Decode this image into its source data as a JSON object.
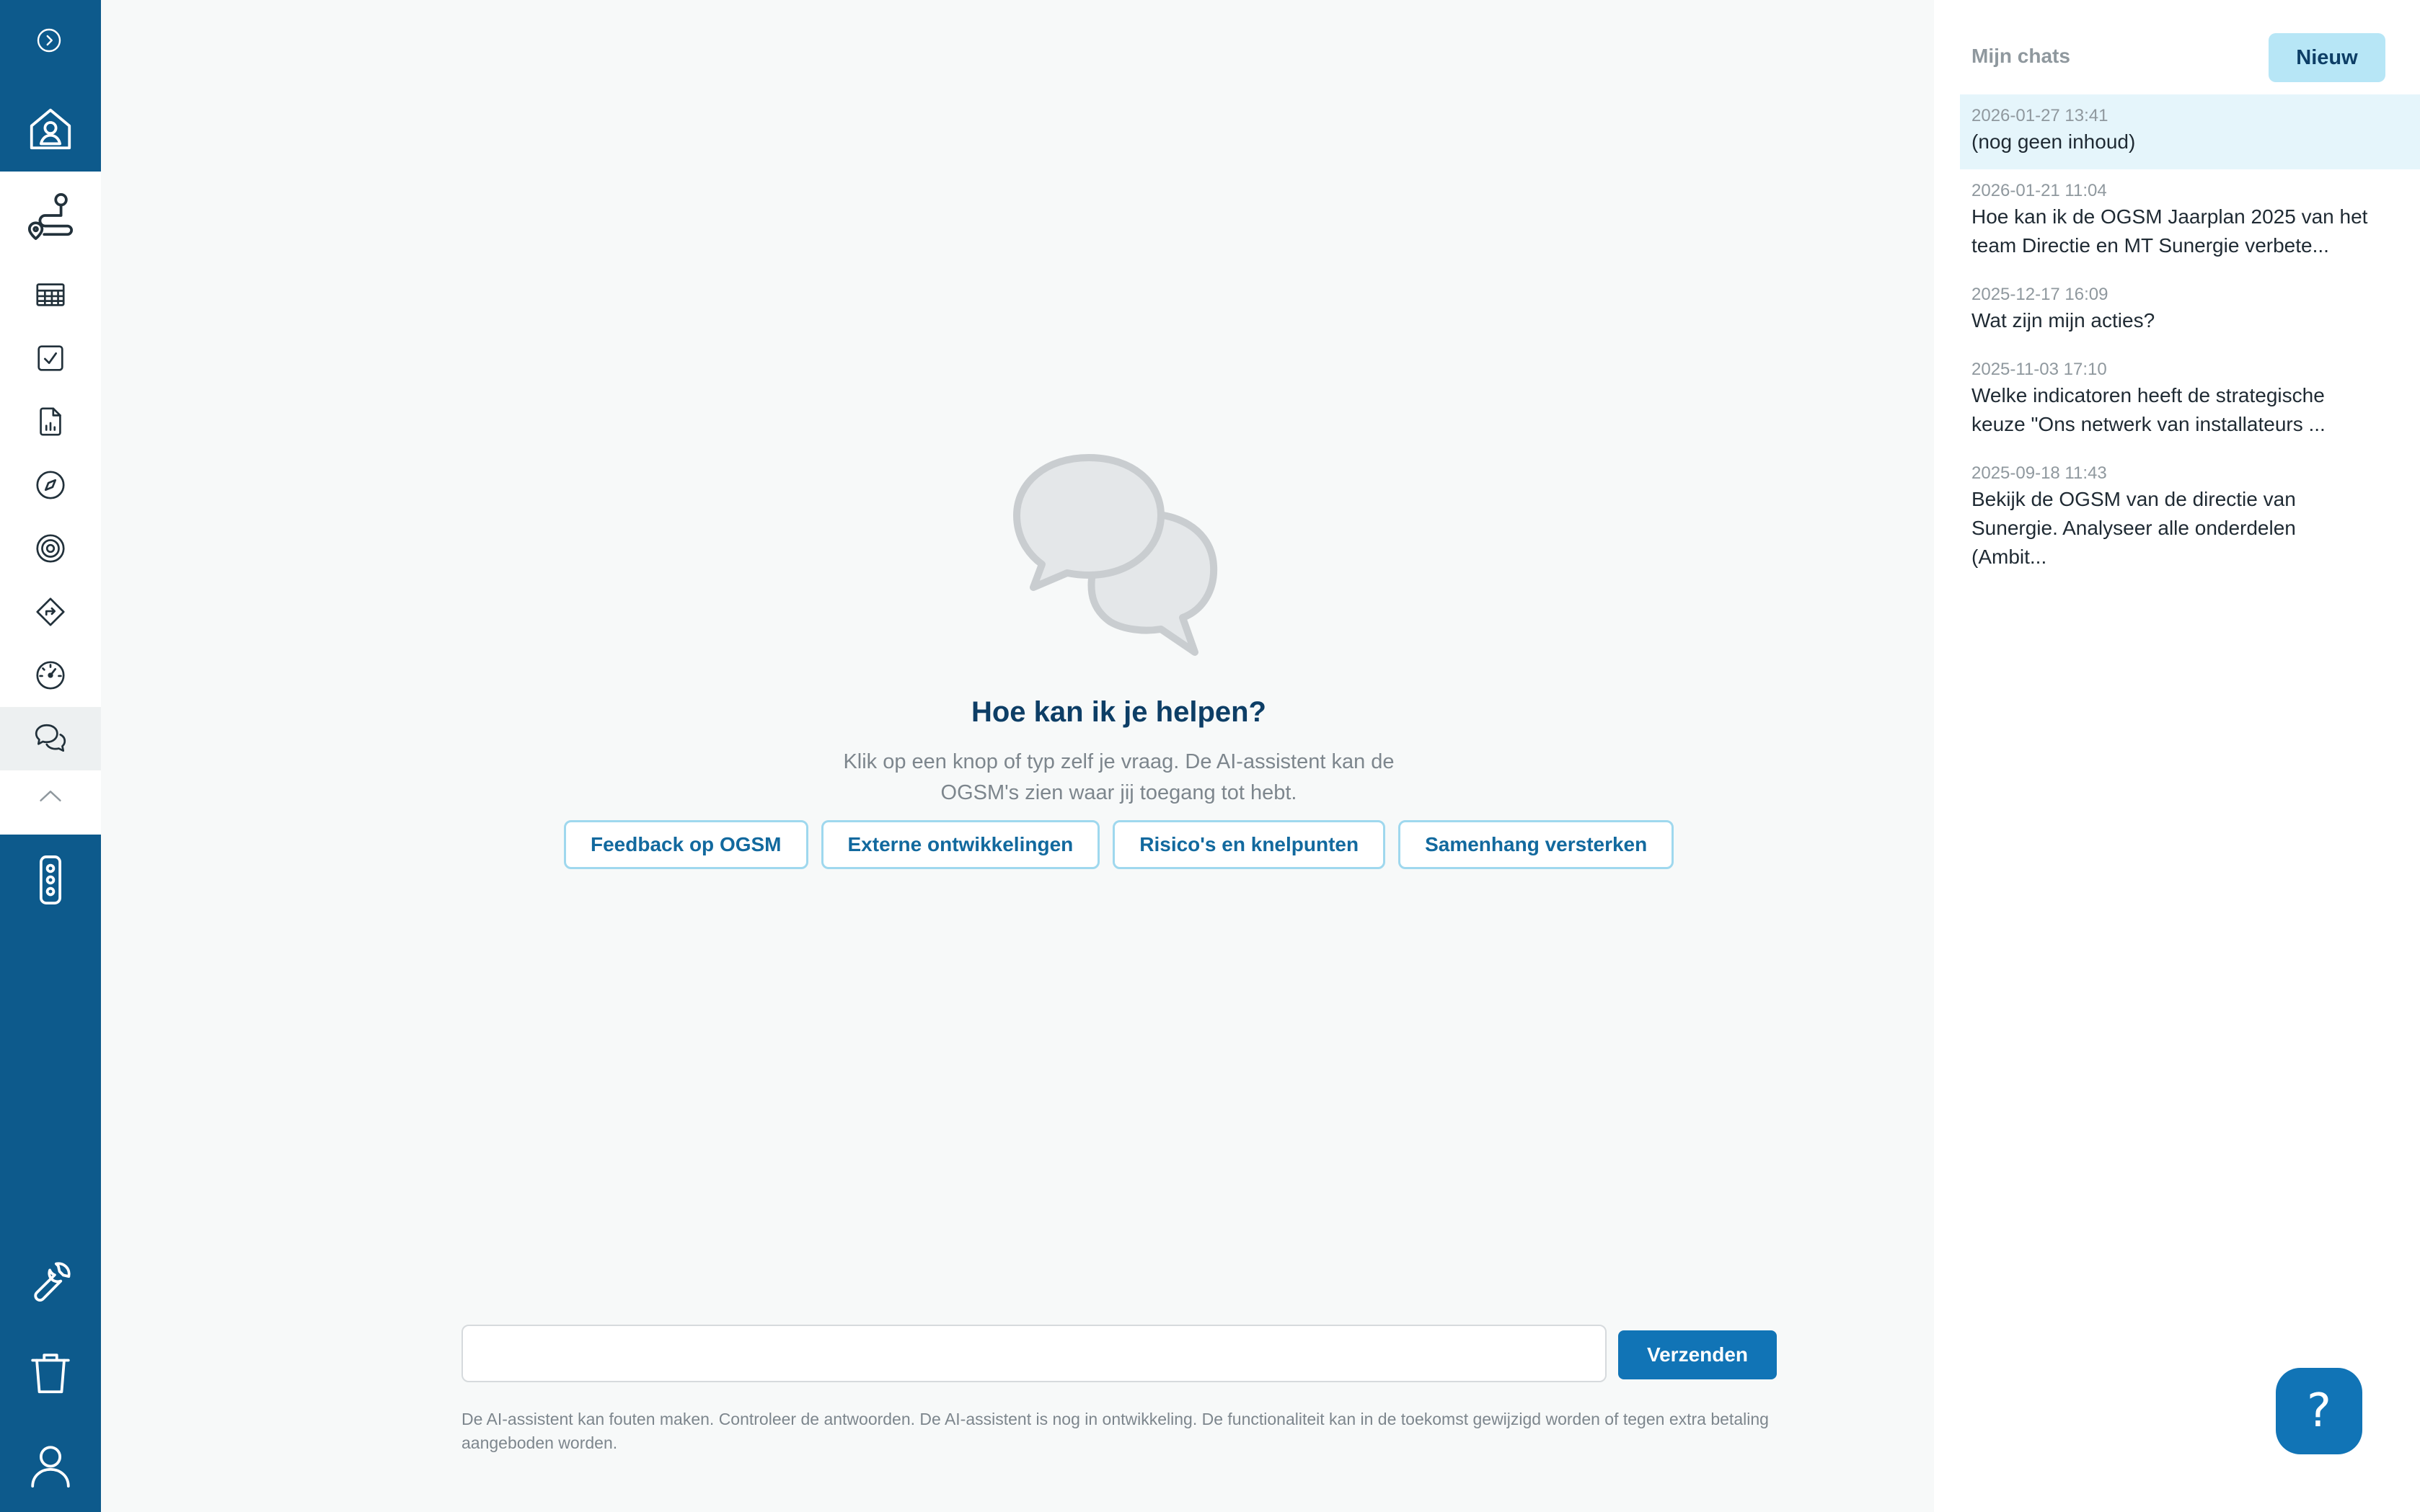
{
  "main": {
    "heading": "Hoe kan ik je helpen?",
    "subtext": "Klik op een knop of typ zelf je vraag. De AI-assistent kan de OGSM's zien waar jij toegang tot hebt.",
    "chips": [
      {
        "label": "Feedback op OGSM"
      },
      {
        "label": "Externe ontwikkelingen"
      },
      {
        "label": "Risico's en knelpunten"
      },
      {
        "label": "Samenhang versterken"
      }
    ],
    "input": {
      "value": "",
      "placeholder": ""
    },
    "send_label": "Verzenden",
    "disclaimer": "De AI-assistent kan fouten maken. Controleer de antwoorden. De AI-assistent is nog in ontwikkeling. De functionaliteit kan in de toekomst gewijzigd worden of tegen extra betaling aangeboden worden."
  },
  "right_panel": {
    "title": "Mijn chats",
    "new_label": "Nieuw",
    "chats": [
      {
        "date": "2026-01-27 13:41",
        "text": "(nog geen inhoud)",
        "selected": true
      },
      {
        "date": "2026-01-21 11:04",
        "text": "Hoe kan ik de OGSM Jaarplan 2025 van het team Directie en MT Sunergie verbete..."
      },
      {
        "date": "2025-12-17 16:09",
        "text": "Wat zijn mijn acties?"
      },
      {
        "date": "2025-11-03 17:10",
        "text": "Welke indicatoren heeft de strategische keuze \"Ons netwerk van installateurs ..."
      },
      {
        "date": "2025-09-18 11:43",
        "text": "Bekijk de OGSM van de directie van Sunergie. Analyseer alle onderdelen (Ambit..."
      }
    ]
  },
  "help": {
    "label": "?"
  },
  "colors": {
    "sidebar": "#0d5a8c",
    "accent": "#1174b6",
    "chip_border": "#9fd8ee",
    "heading": "#0d3e66",
    "selected_chat": "#e5f5fb",
    "new_button": "#b7e6f6"
  },
  "icons": {
    "sidebar_top": [
      "chevron-right-circle-icon",
      "home-user-icon"
    ],
    "sidebar_tools": [
      "route-icon",
      "table-icon",
      "checkbox-icon",
      "report-icon",
      "compass-icon",
      "target-icon",
      "direction-sign-icon",
      "gauge-icon",
      "chat-bubbles-icon",
      "chevron-up-icon"
    ],
    "sidebar_bottom": [
      "traffic-light-icon",
      "wrench-icon",
      "trash-icon",
      "user-icon"
    ]
  }
}
